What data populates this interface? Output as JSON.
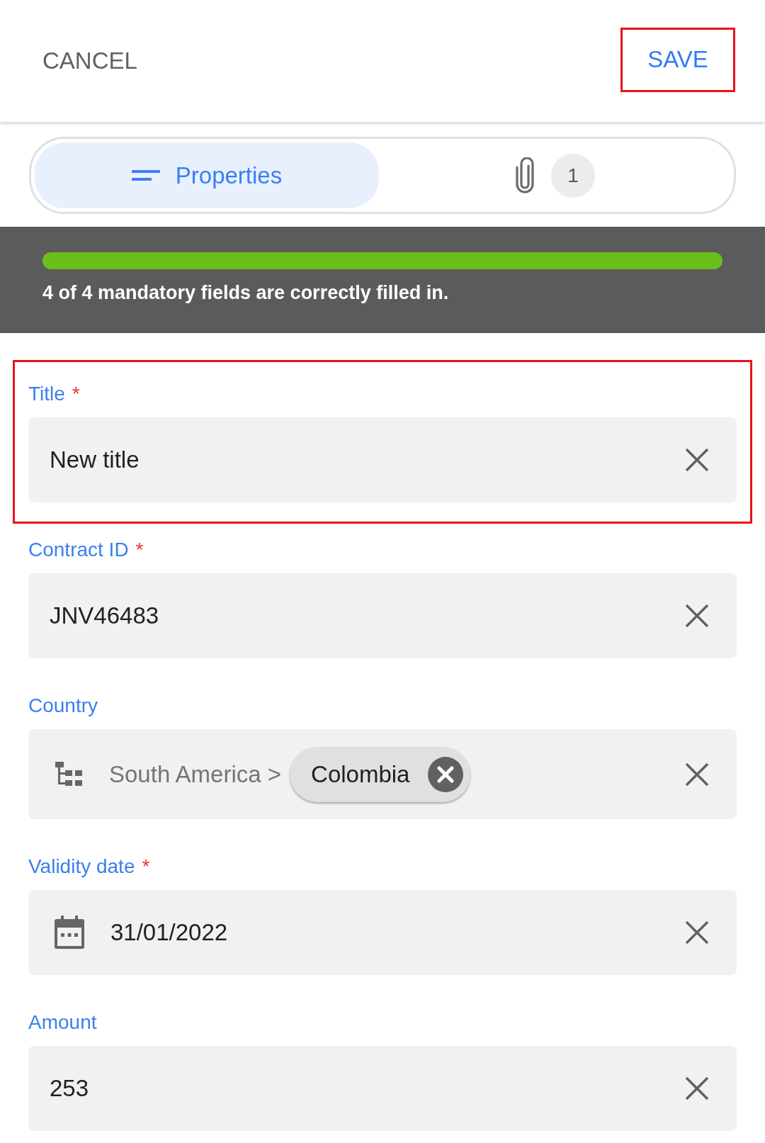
{
  "header": {
    "cancel": {
      "label": "CANCEL"
    },
    "save": {
      "label": "SAVE",
      "highlighted": true
    }
  },
  "tabs": [
    {
      "kind": "properties",
      "label": "Properties",
      "selected": true
    },
    {
      "kind": "attachments",
      "count": "1",
      "selected": false
    }
  ],
  "progress": {
    "level": 1,
    "message": "4 of 4 mandatory fields are correctly filled in."
  },
  "fields": [
    {
      "kind": "text",
      "label": "Title",
      "required_mark": "*",
      "highlighted": true,
      "value": "New title"
    },
    {
      "kind": "text",
      "label": "Contract ID",
      "required_mark": "*",
      "highlighted": false,
      "value": "JNV46483"
    },
    {
      "kind": "tree",
      "label": "Country",
      "highlighted": false,
      "path": "South America >",
      "chip": "Colombia"
    },
    {
      "kind": "date",
      "label": "Validity date",
      "required_mark": "*",
      "highlighted": false,
      "value": "31/01/2022"
    },
    {
      "kind": "text",
      "label": "Amount",
      "highlighted": false,
      "value": "253"
    }
  ]
}
